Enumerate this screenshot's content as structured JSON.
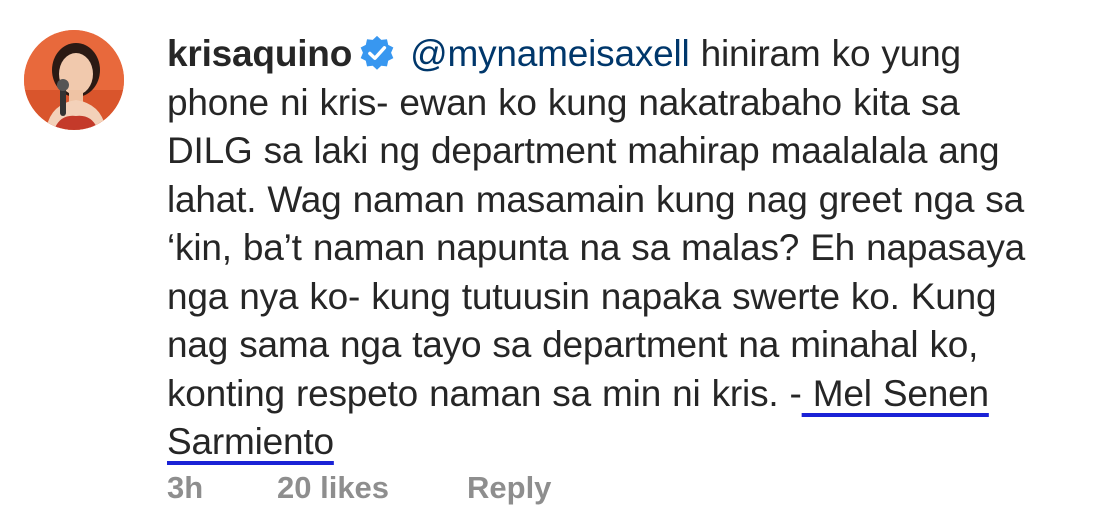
{
  "comment": {
    "username": "krisaquino",
    "verified_icon": "verified-badge-icon",
    "mention": "@mynameisaxell",
    "line1_rest": " hiniram ko yung",
    "line2": "phone ni kris- ewan ko kung nakatrabaho kita sa",
    "line3": "DILG sa laki ng department mahirap maalalala ang",
    "line4": "lahat. Wag naman masamain kung nag greet nga sa",
    "line5": "‘kin, ba’t naman napunta na sa malas? Eh napasaya",
    "line6": "nga nya ko- kung tutuusin napaka swerte ko. Kung",
    "line7": "nag sama nga tayo sa department na minahal ko,",
    "line8_text": "konting respeto naman sa min ni kris. -",
    "author_part1": " Mel Senen",
    "author_part2": "Sarmiento",
    "timestamp": "3h",
    "likes": "20 likes",
    "reply_label": "Reply"
  },
  "colors": {
    "text": "#262626",
    "meta": "#8e8e8e",
    "verified": "#3897f0",
    "underline": "#1a22d6",
    "avatar_bg": "#e86a3a"
  }
}
